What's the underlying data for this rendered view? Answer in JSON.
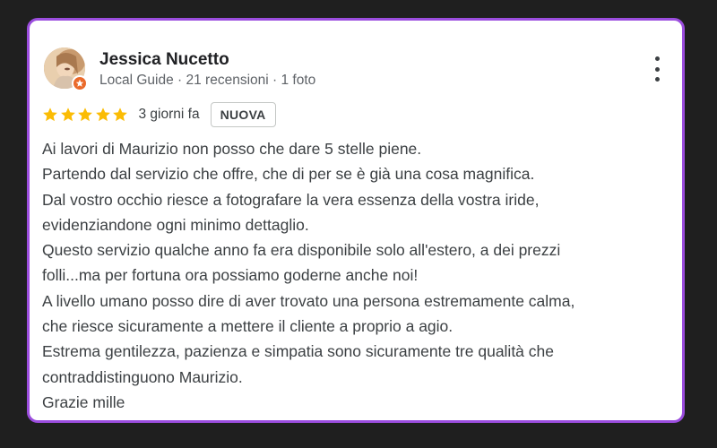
{
  "review": {
    "author": "Jessica Nucetto",
    "meta": "Local Guide · 21 recensioni · 1 foto",
    "rating": 5,
    "rating_max": 5,
    "date": "3 giorni fa",
    "badge": "NUOVA",
    "lines": [
      "Ai lavori di Maurizio non posso che dare 5 stelle piene.",
      "Partendo dal servizio che offre, che di per se è già una cosa magnifica.",
      "Dal vostro occhio riesce a fotografare la vera essenza della vostra iride,",
      "evidenziandone ogni minimo dettaglio.",
      "Questo servizio qualche anno fa era disponibile solo all'estero, a dei prezzi",
      "folli...ma per fortuna ora possiamo goderne anche noi!",
      "A livello umano posso dire di aver trovato una persona estremamente calma,",
      "che riesce sicuramente a mettere il cliente a proprio a agio.",
      "Estrema gentilezza, pazienza e simpatia sono sicuramente tre qualità che",
      "contraddistinguono Maurizio.",
      "Grazie mille"
    ]
  },
  "icons": {
    "avatar": "avatar-photo",
    "badge": "local-guide-badge-icon",
    "menu": "more-vert-icon",
    "star": "star-icon"
  },
  "colors": {
    "card_border": "#9b4dde",
    "star": "#fbbc04",
    "guide_badge": "#ea6a2b",
    "page_background": "#1f1f1f"
  }
}
